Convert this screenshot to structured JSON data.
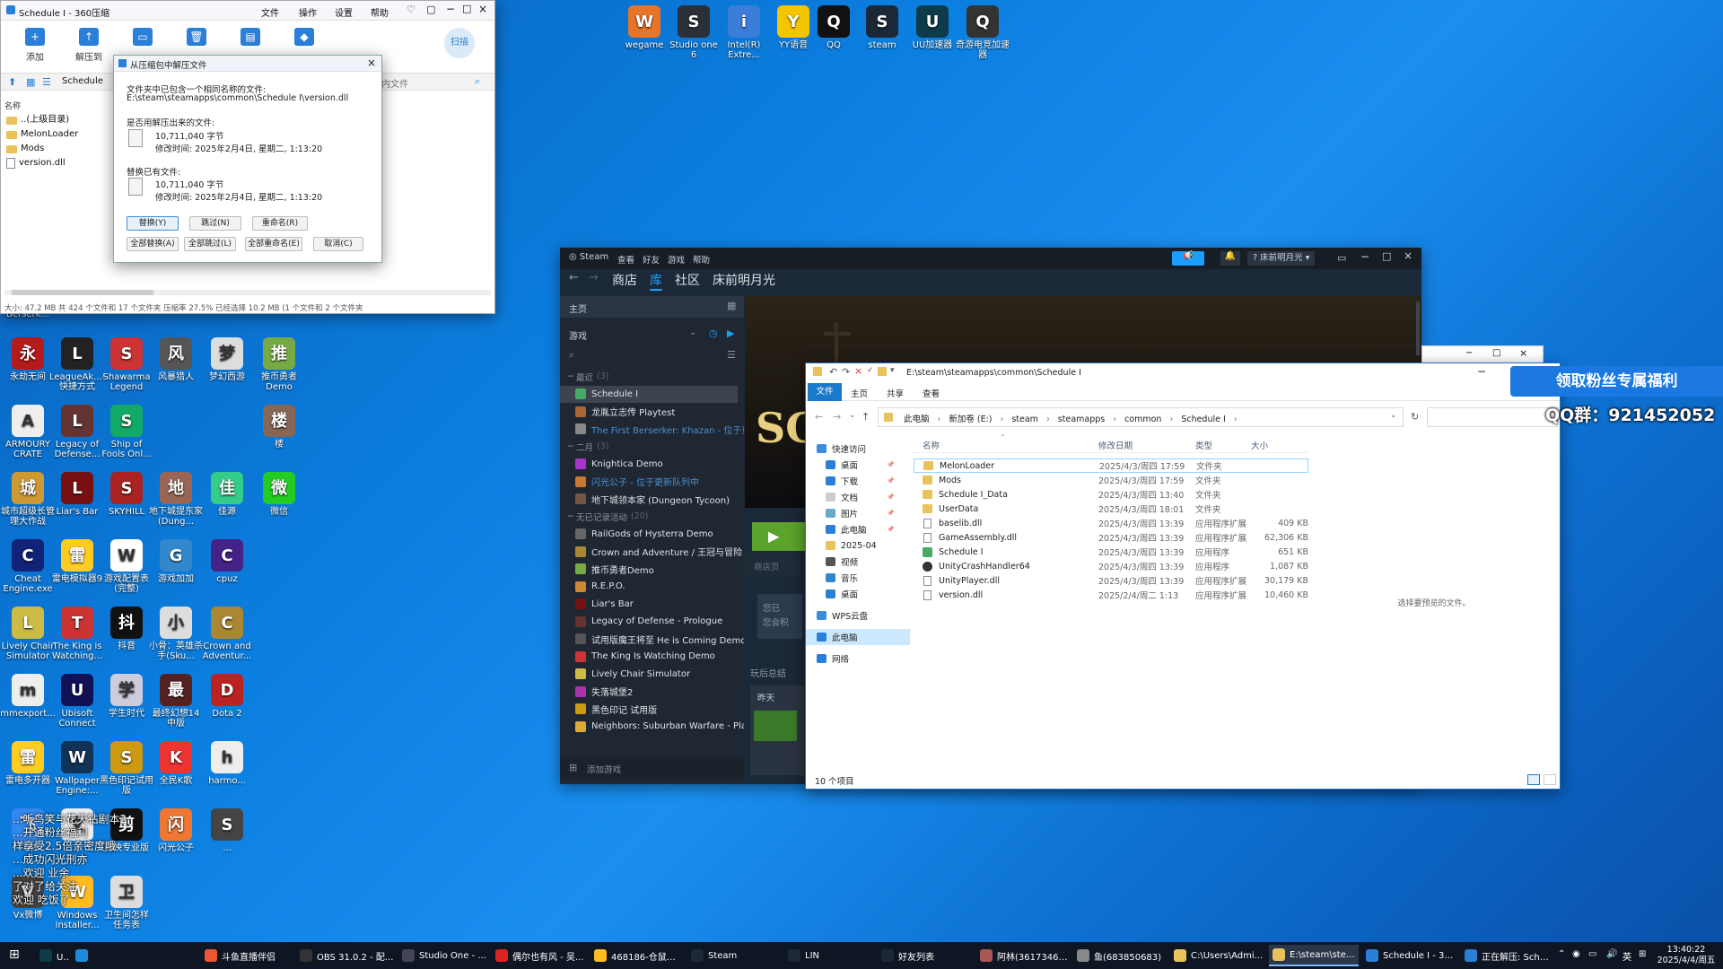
{
  "top_icons": [
    {
      "label": "wegame",
      "color": "#e8742a",
      "glyph": "W"
    },
    {
      "label": "Studio one 6",
      "color": "#2b2f38",
      "glyph": "S"
    },
    {
      "label": "Intel(R) Extre...",
      "color": "#3b7dd8",
      "glyph": "i"
    },
    {
      "label": "YY语音",
      "color": "#f5c400",
      "glyph": "Y"
    },
    {
      "label": "QQ",
      "color": "#111",
      "glyph": "Q"
    },
    {
      "label": "steam",
      "color": "#1b2838",
      "glyph": "S"
    },
    {
      "label": "UU加速器",
      "color": "#0d3b49",
      "glyph": "U"
    },
    {
      "label": "奇游电竞加速器",
      "color": "#333",
      "glyph": "Q"
    }
  ],
  "left_icons": [
    {
      "label": "Berserk...",
      "color": "#333",
      "glyph": "B"
    },
    {
      "label": "永劫无间",
      "color": "#b41b1b",
      "glyph": "永"
    },
    {
      "label": "LeagueAk...-快捷方式",
      "color": "#222",
      "glyph": "L"
    },
    {
      "label": "Shawarma Legend",
      "color": "#c33",
      "glyph": "S"
    },
    {
      "label": "风暴猎人",
      "color": "#555",
      "glyph": "风"
    },
    {
      "label": "梦幻西游",
      "color": "#ddd",
      "glyph": "梦"
    },
    {
      "label": "推币勇者 Demo",
      "color": "#7a4",
      "glyph": "推"
    },
    {
      "label": "ARMOURY CRATE",
      "color": "#eee",
      "glyph": "A"
    },
    {
      "label": "Legacy of Defense...",
      "color": "#633",
      "glyph": "L"
    },
    {
      "label": "Ship of Fools Onl...",
      "color": "#1a6",
      "glyph": "S"
    },
    {
      "label": "楼",
      "color": "#865",
      "glyph": "楼"
    },
    {
      "label": "城市超级长管理大作战",
      "color": "#c93",
      "glyph": "城"
    },
    {
      "label": "Liar's Bar",
      "color": "#711",
      "glyph": "L"
    },
    {
      "label": "SKYHILL",
      "color": "#a22",
      "glyph": "S"
    },
    {
      "label": "地下城提东家(Dung...",
      "color": "#965",
      "glyph": "地"
    },
    {
      "label": "佳源",
      "color": "#3c8",
      "glyph": "佳"
    },
    {
      "label": "微信",
      "color": "#2c2",
      "glyph": "微"
    },
    {
      "label": "Cheat Engine.exe",
      "color": "#127",
      "glyph": "C"
    },
    {
      "label": "雷电模拟器9",
      "color": "#fc2",
      "glyph": "雷"
    },
    {
      "label": "游戏配置表(完整)",
      "color": "#fff",
      "glyph": "W"
    },
    {
      "label": "游戏加加",
      "color": "#38c",
      "glyph": "G"
    },
    {
      "label": "cpuz",
      "color": "#428",
      "glyph": "C"
    },
    {
      "label": "Lively Chair Simulator",
      "color": "#cb4",
      "glyph": "L"
    },
    {
      "label": "The King is Watching...",
      "color": "#c33",
      "glyph": "T"
    },
    {
      "label": "抖音",
      "color": "#111",
      "glyph": "抖"
    },
    {
      "label": "小骨：英雄杀手(Sku...",
      "color": "#ddd",
      "glyph": "小"
    },
    {
      "label": "Crown and Adventur...",
      "color": "#a83",
      "glyph": "C"
    },
    {
      "label": "mmexport...",
      "color": "#eee",
      "glyph": "m"
    },
    {
      "label": "Ubisoft Connect",
      "color": "#115",
      "glyph": "U"
    },
    {
      "label": "学生时代",
      "color": "#ccd",
      "glyph": "学"
    },
    {
      "label": "最终幻想14中版",
      "color": "#522",
      "glyph": "最"
    },
    {
      "label": "Dota 2",
      "color": "#b22",
      "glyph": "D"
    },
    {
      "label": "雷电多开器",
      "color": "#fc2",
      "glyph": "雷"
    },
    {
      "label": "Wallpaper Engine:...",
      "color": "#135",
      "glyph": "W"
    },
    {
      "label": "黑色印记试用版",
      "color": "#c91",
      "glyph": "S"
    },
    {
      "label": "全民K歌",
      "color": "#e33",
      "glyph": "K"
    },
    {
      "label": "harmo...",
      "color": "#eee",
      "glyph": "h"
    },
    {
      "label": "飞书",
      "color": "#38e",
      "glyph": "飞"
    },
    {
      "label": "...",
      "color": "#eee",
      "glyph": "文"
    },
    {
      "label": "剪映专业版",
      "color": "#111",
      "glyph": "剪"
    },
    {
      "label": "闪光公子",
      "color": "#e73",
      "glyph": "闪"
    },
    {
      "label": "...",
      "color": "#444",
      "glyph": "S"
    },
    {
      "label": "Vx微博",
      "color": "#444",
      "glyph": "V"
    },
    {
      "label": "Windows Installer...",
      "color": "#fb2",
      "glyph": "W"
    },
    {
      "label": "卫生间怎样 任务表",
      "color": "#ddd",
      "glyph": "卫"
    }
  ],
  "overlay": {
    "l1": "...听鸟笑与花天钻剧本2",
    "l2": "...开通粉丝福利",
    "l3": "样享受2.5倍亲密度哦",
    "l4": "...成功闪光刑亦",
    "l5": "...欢迎 业余",
    "l6": "了对了给关注",
    "l7": "欢迎 吃饭了"
  },
  "zip": {
    "title": "Schedule I - 360压缩",
    "menu": [
      "文件",
      "操作",
      "设置",
      "帮助"
    ],
    "toolbar": [
      "添加",
      "解压到",
      "",
      "",
      "",
      "",
      ""
    ],
    "scan": "扫描",
    "path": "Schedule",
    "search_ph": "内文件",
    "col_name": "名称",
    "files": [
      "..(上级目录)",
      "MelonLoader",
      "Mods",
      "version.dll"
    ],
    "status": "大小: 47.2 MB 共 424 个文件和 17 个文件夹 压缩率 27.5% 已经选择 10.2 MB (1 个文件和 2 个文件夹"
  },
  "dialog": {
    "title": "从压缩包中解压文件",
    "l1": "文件夹中已包含一个相同名称的文件:",
    "l2": "E:\\steam\\steamapps\\common\\Schedule I\\version.dll",
    "l3": "是否用解压出来的文件:",
    "size1": "10,711,040 字节",
    "time1": "修改时间: 2025年2月4日, 星期二, 1:13:20",
    "l4": "替换已有文件:",
    "size2": "10,711,040 字节",
    "time2": "修改时间: 2025年2月4日, 星期二, 1:13:20",
    "btn_replace": "替换(Y)",
    "btn_skip": "跳过(N)",
    "btn_rename": "重命名(R)",
    "btn_replace_all": "全部替换(A)",
    "btn_skip_all": "全部跳过(L)",
    "btn_rename_all": "全部重命名(E)",
    "btn_cancel": "取消(C)"
  },
  "steam": {
    "logo": "Steam",
    "menu": [
      "查看",
      "好友",
      "游戏",
      "帮助"
    ],
    "nav": [
      "商店",
      "库",
      "社区",
      "床前明月光"
    ],
    "user": "床前明月光",
    "home": "主页",
    "games_label": "游戏",
    "sec_recent": "最近",
    "sec_recent_count": "(3)",
    "recent": [
      {
        "name": "Schedule I",
        "color": "#4a6",
        "sel": true
      },
      {
        "name": "龙胤立志传 Playtest",
        "color": "#a63"
      },
      {
        "name": "The First Berserker: Khazan - 位于更新",
        "color": "#888",
        "upd": true
      }
    ],
    "sec_feb": "二月",
    "sec_feb_count": "(3)",
    "feb": [
      {
        "name": "Knightica Demo",
        "color": "#a3c"
      },
      {
        "name": "闪光公子 - 位于更新队列中",
        "color": "#c73",
        "upd": true
      },
      {
        "name": "地下城领本家 (Dungeon Tycoon)",
        "color": "#754"
      }
    ],
    "sec_none": "无已记录活动",
    "sec_none_count": "(20)",
    "none": [
      {
        "name": "RailGods of Hysterra Demo",
        "color": "#666"
      },
      {
        "name": "Crown and Adventure / 王冠与冒险",
        "color": "#a83"
      },
      {
        "name": "推币勇者Demo",
        "color": "#7a4"
      },
      {
        "name": "R.E.P.O.",
        "color": "#c83"
      },
      {
        "name": "Liar's Bar",
        "color": "#711"
      },
      {
        "name": "Legacy of Defense - Prologue",
        "color": "#633"
      },
      {
        "name": "试用版魔王将至 He is Coming Demo",
        "color": "#555"
      },
      {
        "name": "The King Is Watching Demo",
        "color": "#c33"
      },
      {
        "name": "Lively Chair Simulator",
        "color": "#cb4"
      },
      {
        "name": "失落城堡2",
        "color": "#a3a"
      },
      {
        "name": "黑色印记 试用版",
        "color": "#c91"
      },
      {
        "name": "Neighbors: Suburban Warfare - Play",
        "color": "#da3"
      }
    ],
    "add_game": "添加游戏",
    "store_frag": "商店页",
    "msg1": "您已",
    "msg2": "您会积",
    "play_stats": "玩后总结",
    "yesterday": "昨天",
    "banner_letters": "SC"
  },
  "explorer": {
    "path": "E:\\steam\\steamapps\\common\\Schedule I",
    "tabs": [
      "文件",
      "主页",
      "共享",
      "查看"
    ],
    "crumbs": [
      "此电脑",
      "新加卷 (E:)",
      "steam",
      "steamapps",
      "common",
      "Schedule I"
    ],
    "cols": [
      "名称",
      "修改日期",
      "类型",
      "大小"
    ],
    "nav": [
      {
        "label": "快速访问",
        "color": "#3a8de0"
      },
      {
        "label": "桌面",
        "color": "#2a7fd8"
      },
      {
        "label": "下载",
        "color": "#2a7fd8"
      },
      {
        "label": "文档",
        "color": "#ccc"
      },
      {
        "label": "图片",
        "color": "#6ac"
      },
      {
        "label": "此电脑",
        "color": "#2a7fd8"
      },
      {
        "label": "2025-04",
        "color": "#e8c25a"
      },
      {
        "label": "视频",
        "color": "#555"
      },
      {
        "label": "音乐",
        "color": "#38c"
      },
      {
        "label": "桌面",
        "color": "#2a7fd8"
      },
      {
        "label": "WPS云盘",
        "color": "#3a8de0"
      },
      {
        "label": "此电脑",
        "color": "#2a7fd8"
      },
      {
        "label": "网络",
        "color": "#2a7fd8"
      }
    ],
    "files": [
      {
        "name": "MelonLoader",
        "date": "2025/4/3/周四 17:59",
        "type": "文件夹",
        "size": "",
        "kind": "folder"
      },
      {
        "name": "Mods",
        "date": "2025/4/3/周四 17:59",
        "type": "文件夹",
        "size": "",
        "kind": "folder"
      },
      {
        "name": "Schedule I_Data",
        "date": "2025/4/3/周四 13:40",
        "type": "文件夹",
        "size": "",
        "kind": "folder"
      },
      {
        "name": "UserData",
        "date": "2025/4/3/周四 18:01",
        "type": "文件夹",
        "size": "",
        "kind": "folder"
      },
      {
        "name": "baselib.dll",
        "date": "2025/4/3/周四 13:39",
        "type": "应用程序扩展",
        "size": "409 KB",
        "kind": "dll"
      },
      {
        "name": "GameAssembly.dll",
        "date": "2025/4/3/周四 13:39",
        "type": "应用程序扩展",
        "size": "62,306 KB",
        "kind": "dll"
      },
      {
        "name": "Schedule I",
        "date": "2025/4/3/周四 13:39",
        "type": "应用程序",
        "size": "651 KB",
        "kind": "exe"
      },
      {
        "name": "UnityCrashHandler64",
        "date": "2025/4/3/周四 13:39",
        "type": "应用程序",
        "size": "1,087 KB",
        "kind": "exe2"
      },
      {
        "name": "UnityPlayer.dll",
        "date": "2025/4/3/周四 13:39",
        "type": "应用程序扩展",
        "size": "30,179 KB",
        "kind": "dll"
      },
      {
        "name": "version.dll",
        "date": "2025/2/4/周二 1:13",
        "type": "应用程序扩展",
        "size": "10,460 KB",
        "kind": "dll"
      }
    ],
    "preview": "选择要预览的文件。",
    "count": "10 个项目"
  },
  "promo": {
    "line1": "领取粉丝专属福利",
    "line2": "QQ群：921452052"
  },
  "taskbar": {
    "items": [
      {
        "label": "UU加速器",
        "color": "#0d3b49"
      },
      {
        "label": "",
        "color": "#1e8be0"
      },
      {
        "label": "斗鱼直播伴侣",
        "color": "#e53"
      },
      {
        "label": "OBS 31.0.2 - 配...",
        "color": "#333"
      },
      {
        "label": "Studio One - ...",
        "color": "#445"
      },
      {
        "label": "偶尔也有风 - 吴...",
        "color": "#d22"
      },
      {
        "label": "468186-仓鼠特...",
        "color": "#fb2"
      },
      {
        "label": "Steam",
        "color": "#1b2838"
      },
      {
        "label": "LIN",
        "color": "#1b2838"
      },
      {
        "label": "好友列表",
        "color": "#1b2838"
      },
      {
        "label": "阿林(361734613)",
        "color": "#a55"
      },
      {
        "label": "鱼(683850683)",
        "color": "#888"
      },
      {
        "label": "C:\\Users\\Admi...",
        "color": "#e8c25a"
      },
      {
        "label": "E:\\steam\\stea...",
        "color": "#e8c25a"
      },
      {
        "label": "Schedule I - 36...",
        "color": "#2a7fd8"
      },
      {
        "label": "正在解压: Sche...",
        "color": "#2a7fd8"
      }
    ],
    "ime": "英",
    "time": "13:40:22",
    "date": "2025/4/4/周五"
  }
}
